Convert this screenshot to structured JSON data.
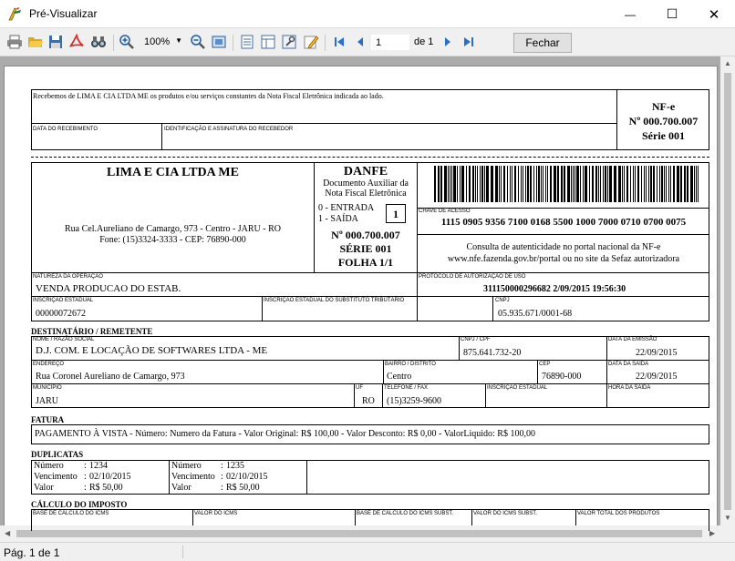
{
  "window": {
    "title": "Pré-Visualizar",
    "minimize": "—",
    "maximize": "☐",
    "close": "✕"
  },
  "toolbar": {
    "zoom": "100%",
    "page_current": "1",
    "page_of": "de 1",
    "close_label": "Fechar"
  },
  "status": {
    "page_info": "Pág. 1 de 1"
  },
  "canhoto": {
    "receipt_text": "Recebemos de LIMA E CIA LTDA ME os produtos e/ou serviços constantes da Nota Fiscal Eletrônica indicada ao lado.",
    "date_label": "DATA DO RECEBIMENTO",
    "sign_label": "IDENTIFICAÇÃO E ASSINATURA DO RECEBEDOR",
    "nfe": "NF-e",
    "number": "Nº 000.700.007",
    "series": "Série 001"
  },
  "emitente": {
    "name": "LIMA E CIA LTDA ME",
    "address": "Rua Cel.Aureliano de Camargo, 973 - Centro - JARU - RO",
    "phone": "Fone: (15)3324-3333 - CEP: 76890-000"
  },
  "danfe": {
    "title": "DANFE",
    "sub1": "Documento Auxiliar da",
    "sub2": "Nota Fiscal Eletrônica",
    "entrada": "0 - ENTRADA",
    "saida": "1 - SAÍDA",
    "tipo": "1",
    "number": "Nº 000.700.007",
    "series": "SÉRIE 001",
    "folha": "FOLHA 1/1"
  },
  "chave": {
    "label": "CHAVE DE ACESSO",
    "value": "1115 0905 9356 7100 0168 5500 1000 7000 0710 0700 0075",
    "consulta1": "Consulta de autenticidade no portal nacional da NF-e",
    "consulta2": "www.nfe.fazenda.gov.br/portal ou no site da Sefaz autorizadora"
  },
  "natureza": {
    "label": "NATUREZA DA OPERAÇÃO",
    "value": "VENDA PRODUCAO DO ESTAB."
  },
  "protocolo": {
    "label": "PROTOCOLO DE AUTORIZAÇÃO DE USO",
    "value": "311150000296682 2/09/2015 19:56:30"
  },
  "ie": {
    "label": "INSCRIÇÃO ESTADUAL",
    "value": "00000072672"
  },
  "ie_st": {
    "label": "INSCRIÇÃO ESTADUAL DO SUBSTITUTO TRIBUTÁRIO",
    "value": ""
  },
  "cnpj": {
    "label": "CNPJ",
    "value": "05.935.671/0001-68"
  },
  "destinatario": {
    "section": "DESTINATÁRIO / REMETENTE",
    "name_label": "NOME / RAZÃO SOCIAL",
    "name": "D.J. COM. E LOCAÇÃO DE SOFTWARES LTDA - ME",
    "cnpj_label": "CNPJ / CPF",
    "cnpj": "875.641.732-20",
    "emissao_label": "DATA DA EMISSÃO",
    "emissao": "22/09/2015",
    "endereco_label": "ENDEREÇO",
    "endereco": "Rua Coronel Aureliano de Camargo, 973",
    "bairro_label": "BAIRRO / DISTRITO",
    "bairro": "Centro",
    "cep_label": "CEP",
    "cep": "76890-000",
    "saida_label": "DATA DA SAÍDA",
    "saida": "22/09/2015",
    "municipio_label": "MUNICÍPIO",
    "municipio": "JARU",
    "uf_label": "UF",
    "uf": "RO",
    "fone_label": "TELEFONE / FAX",
    "fone": "(15)3259-9600",
    "ie_label": "INSCRIÇÃO ESTADUAL",
    "ie": "",
    "hora_label": "HORA DA SAÍDA",
    "hora": ""
  },
  "fatura": {
    "section": "FATURA",
    "text": "PAGAMENTO À VISTA   -   Número:  Numero da Fatura   -   Valor Original: R$ 100,00   -   Valor Desconto:  R$ 0,00   -   ValorLiquido: R$ 100,00"
  },
  "duplicatas": {
    "section": "DUPLICATAS",
    "items": [
      {
        "numero_label": "Número",
        "numero": "1234",
        "venc_label": "Vencimento",
        "venc": "02/10/2015",
        "valor_label": "Valor",
        "valor": "R$ 50,00"
      },
      {
        "numero_label": "Número",
        "numero": "1235",
        "venc_label": "Vencimento",
        "venc": "02/10/2015",
        "valor_label": "Valor",
        "valor": "R$ 50,00"
      }
    ]
  },
  "imposto": {
    "section": "CÁLCULO DO IMPOSTO",
    "labels": [
      "BASE DE CÁLCULO DO ICMS",
      "VALOR DO ICMS",
      "BASE DE CÁLCULO DO ICMS SUBST.",
      "VALOR DO ICMS SUBST.",
      "VALOR TOTAL DOS PRODUTOS"
    ]
  }
}
